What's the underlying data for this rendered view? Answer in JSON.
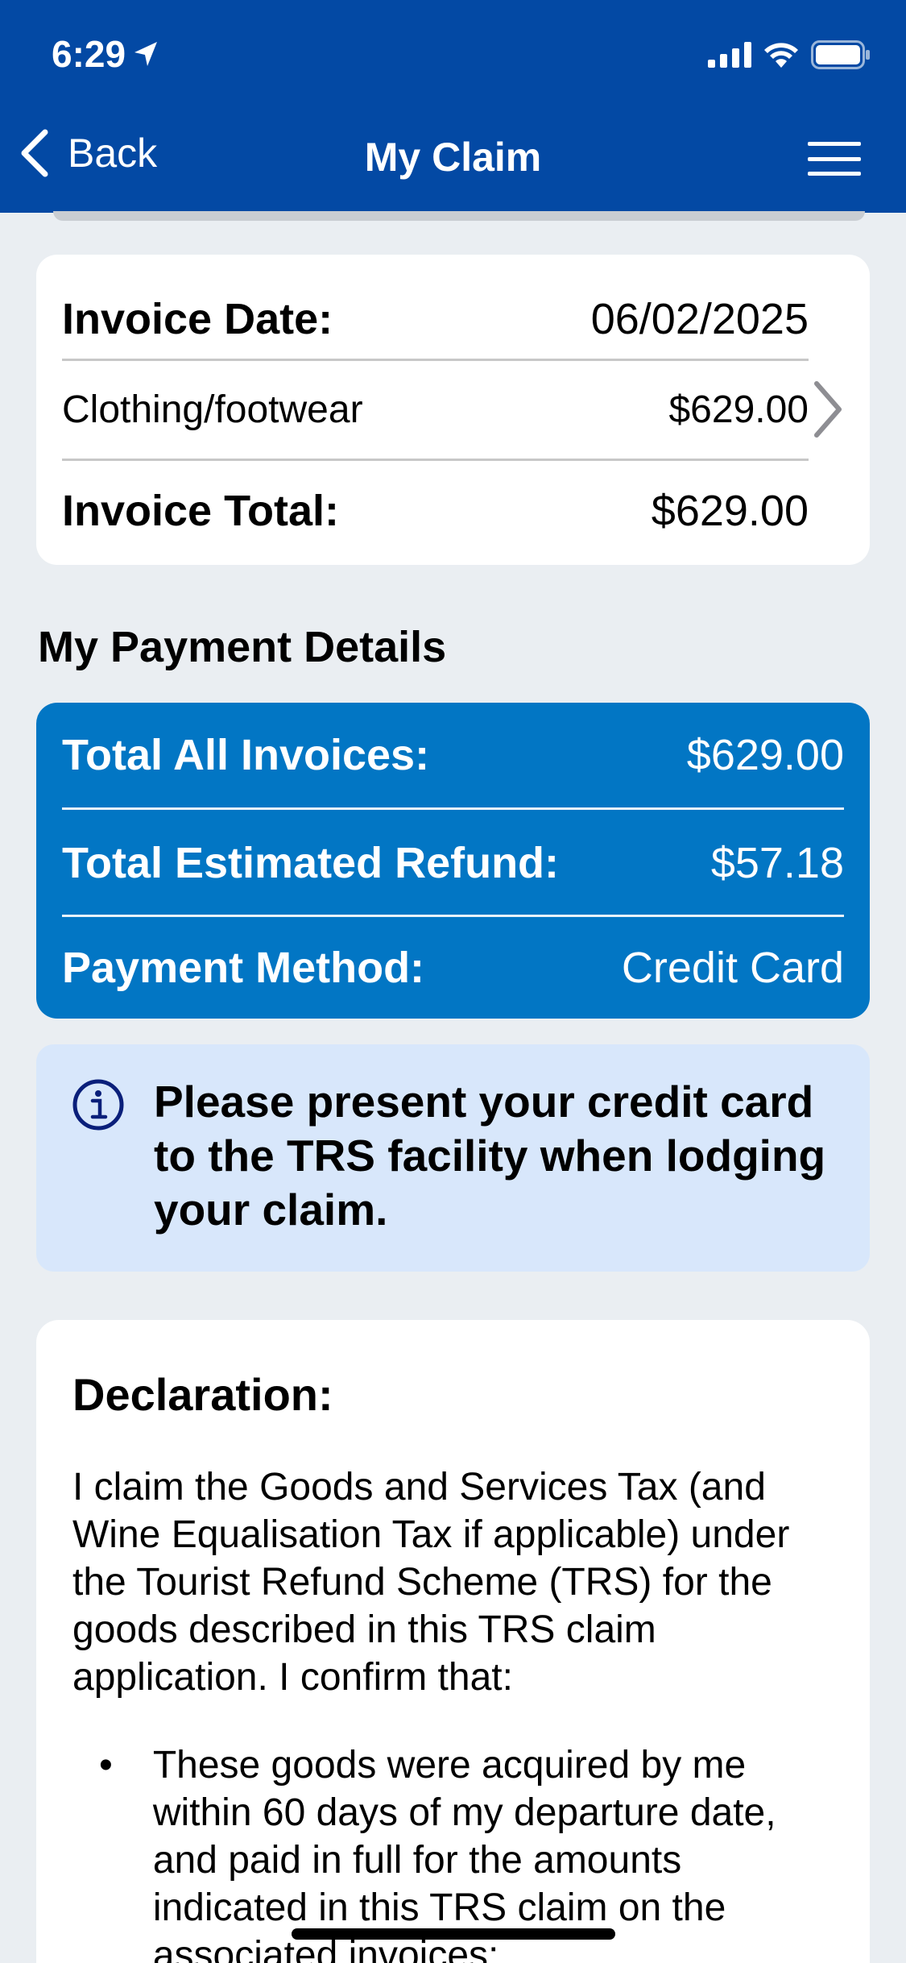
{
  "status_bar": {
    "time": "6:29"
  },
  "nav": {
    "back_label": "Back",
    "title": "My Claim"
  },
  "invoice": {
    "date_label": "Invoice Date:",
    "date_value": "06/02/2025",
    "item_label": "Clothing/footwear",
    "item_amount": "$629.00",
    "total_label": "Invoice Total:",
    "total_value": "$629.00"
  },
  "payment": {
    "section_title": "My Payment Details",
    "total_invoices_label": "Total All Invoices:",
    "total_invoices_value": "$629.00",
    "refund_label": "Total Estimated Refund:",
    "refund_value": "$57.18",
    "method_label": "Payment Method:",
    "method_value": "Credit Card"
  },
  "info": {
    "message": "Please present your credit card to the TRS facility when lodging your claim."
  },
  "declaration": {
    "title": "Declaration:",
    "body": "I claim the Goods and Services Tax (and Wine Equalisation Tax if applicable) under the Tourist Refund Scheme (TRS) for the goods described in this TRS claim application. I confirm that:",
    "bullets": [
      "These goods were acquired by me within 60 days of my departure date, and paid in full for the amounts indicated in this TRS claim on the associated invoices;"
    ]
  },
  "colors": {
    "header": "#0349a4",
    "payment_card": "#0276c4",
    "info_bg": "#d8e7fb",
    "page_bg": "#eaeef2"
  }
}
